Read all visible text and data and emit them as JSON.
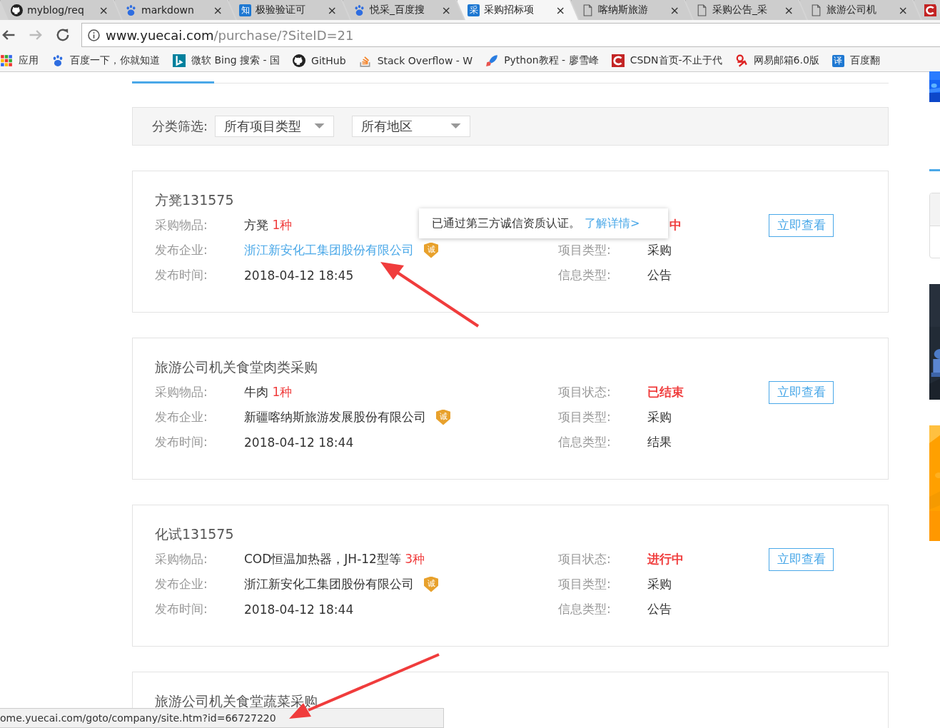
{
  "browser": {
    "tabs": [
      {
        "title": "myblog/req",
        "kind": "github",
        "selected": false
      },
      {
        "title": "markdown",
        "kind": "baidu",
        "selected": false
      },
      {
        "title": "极验验证可",
        "kind": "badge",
        "badge": "知",
        "selected": false
      },
      {
        "title": "悦采_百度搜",
        "kind": "baidu",
        "selected": false
      },
      {
        "title": "采购招标项",
        "kind": "badge",
        "badge": "采",
        "selected": true
      },
      {
        "title": "喀纳斯旅游",
        "kind": "page",
        "selected": false
      },
      {
        "title": "采购公告_采",
        "kind": "page",
        "selected": false
      },
      {
        "title": "旅游公司机",
        "kind": "page",
        "selected": false
      },
      {
        "kind": "csdn",
        "selected": false
      }
    ],
    "close_glyph": "×",
    "address": {
      "host": "www.yuecai.com",
      "path": "/purchase/?SiteID=21"
    },
    "bookmarks": [
      {
        "label": "应用",
        "kind": "apps"
      },
      {
        "label": "百度一下，你就知道",
        "kind": "baidu"
      },
      {
        "label": "微软 Bing 搜索 - 国",
        "kind": "bing"
      },
      {
        "label": "GitHub",
        "kind": "github"
      },
      {
        "label": "Stack Overflow - W",
        "kind": "stackoverflow"
      },
      {
        "label": "Python教程 - 廖雪峰",
        "kind": "rocket"
      },
      {
        "label": "CSDN首页-不止于代",
        "kind": "csdn"
      },
      {
        "label": "网易邮箱6.0版",
        "kind": "netease"
      },
      {
        "label": "百度翻",
        "kind": "badge",
        "badge": "译"
      }
    ]
  },
  "filter": {
    "label": "分类筛选:",
    "dropdowns": [
      "所有项目类型",
      "所有地区"
    ]
  },
  "cards": [
    {
      "title": "方凳131575",
      "item_label": "采购物品:",
      "item": "方凳",
      "count": "1种",
      "company_label": "发布企业:",
      "company": "浙江新安化工集团股份有限公司",
      "company_link": true,
      "badge": "诚",
      "time_label": "发布时间:",
      "time": "2018-04-12 18:45",
      "status": "中",
      "type_label": "项目类型:",
      "type": "采购",
      "info_label": "信息类型:",
      "info": "公告",
      "button": "立即查看"
    },
    {
      "title": "旅游公司机关食堂肉类采购",
      "item_label": "采购物品:",
      "item": "牛肉",
      "count": "1种",
      "company_label": "发布企业:",
      "company": "新疆喀纳斯旅游发展股份有限公司",
      "company_link": false,
      "badge": "诚",
      "time_label": "发布时间:",
      "time": "2018-04-12 18:44",
      "status_label": "项目状态:",
      "status": "已结束",
      "type_label": "项目类型:",
      "type": "采购",
      "info_label": "信息类型:",
      "info": "结果",
      "button": "立即查看"
    },
    {
      "title": "化试131575",
      "item_label": "采购物品:",
      "item": "COD恒温加热器，JH-12型等",
      "count": "3种",
      "company_label": "发布企业:",
      "company": "浙江新安化工集团股份有限公司",
      "company_link": false,
      "badge": "诚",
      "time_label": "发布时间:",
      "time": "2018-04-12 18:44",
      "status_label": "项目状态:",
      "status": "进行中",
      "type_label": "项目类型:",
      "type": "采购",
      "info_label": "信息类型:",
      "info": "公告",
      "button": "立即查看"
    },
    {
      "title": "旅游公司机关食堂蔬菜采购"
    }
  ],
  "tooltip": {
    "text": "已通过第三方诚信资质认证。",
    "link": "了解详情>"
  },
  "status_bar": {
    "text": "ome.yuecai.com/goto/company/site.htm?id=66727220"
  }
}
